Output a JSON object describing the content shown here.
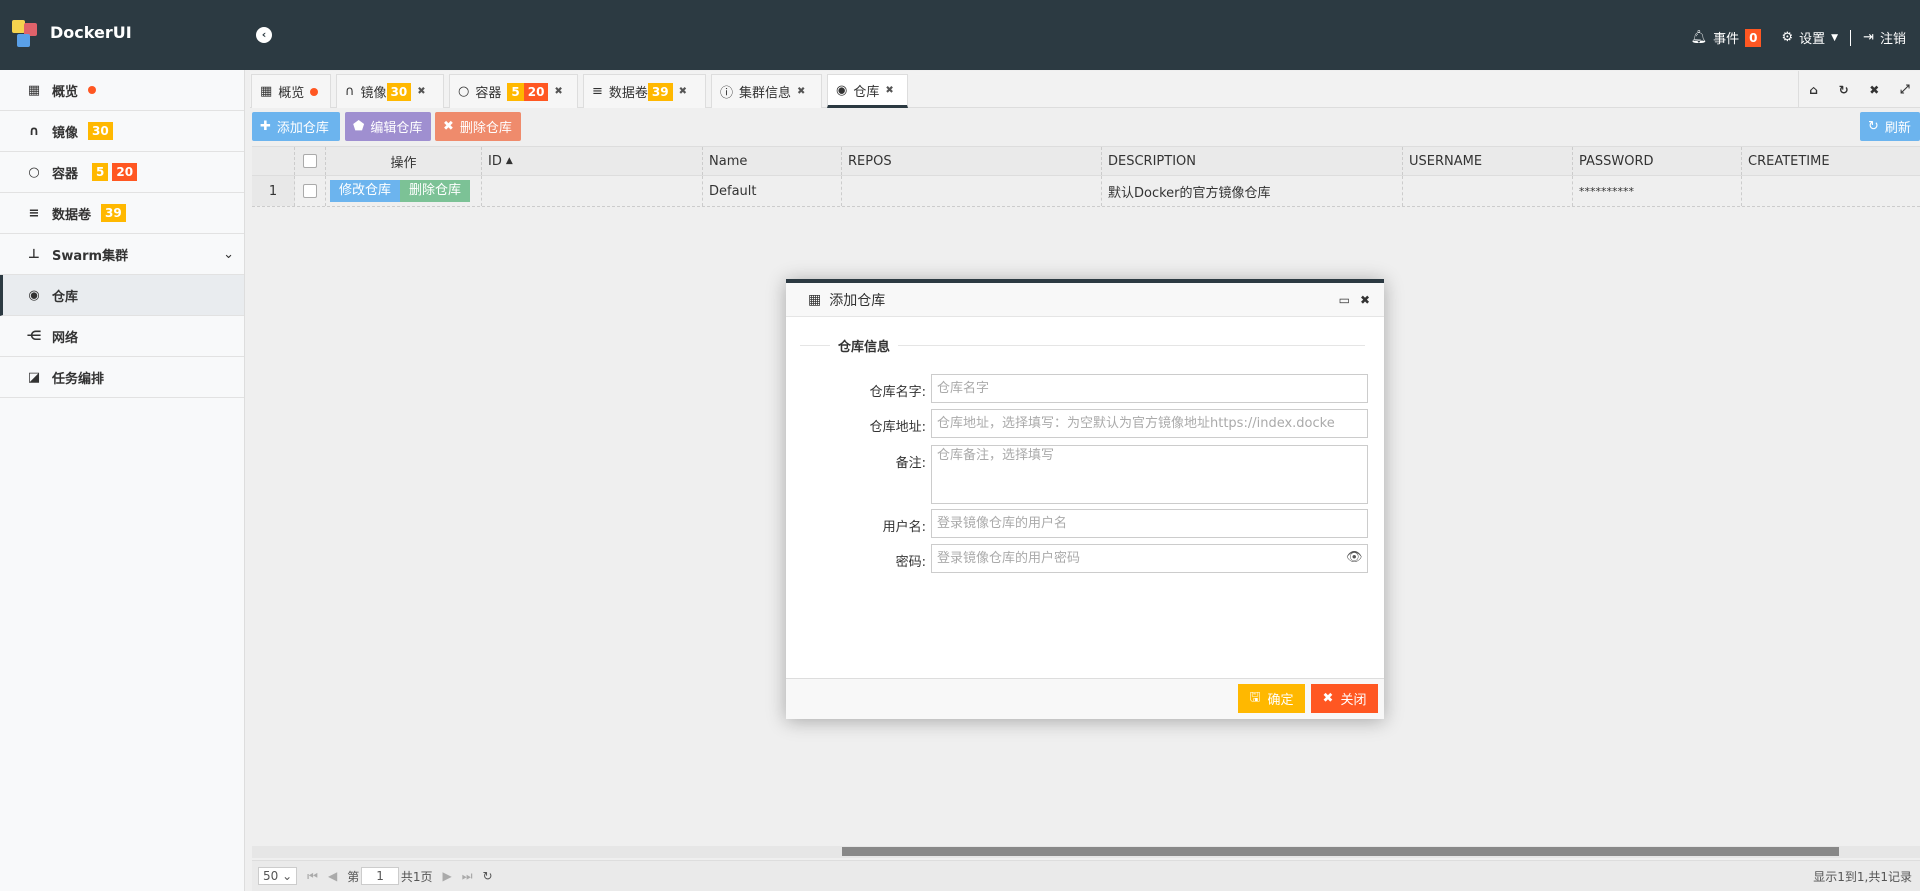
{
  "header": {
    "brand": "DockerUI",
    "events_label": "事件",
    "events_count": "0",
    "settings_label": "设置",
    "logout_label": "注销"
  },
  "sidebar": {
    "items": [
      {
        "label": "概览"
      },
      {
        "label": "镜像",
        "badge": "30"
      },
      {
        "label": "容器",
        "badge1": "5",
        "badge2": "20"
      },
      {
        "label": "数据卷",
        "badge": "39"
      },
      {
        "label": "Swarm集群"
      },
      {
        "label": "仓库"
      },
      {
        "label": "网络"
      },
      {
        "label": "任务编排"
      }
    ]
  },
  "tabs": [
    {
      "label": "概览"
    },
    {
      "label": "镜像",
      "badge": "30"
    },
    {
      "label": "容器",
      "badge1": "5",
      "badge2": "20"
    },
    {
      "label": "数据卷",
      "badge": "39"
    },
    {
      "label": "集群信息"
    },
    {
      "label": "仓库"
    }
  ],
  "toolbar": {
    "add": "添加仓库",
    "edit": "编辑仓库",
    "delete": "删除仓库",
    "refresh": "刷新"
  },
  "table": {
    "columns": [
      "操作",
      "ID",
      "Name",
      "REPOS",
      "DESCRIPTION",
      "USERNAME",
      "PASSWORD",
      "CREATETIME"
    ],
    "rows": [
      {
        "num": "1",
        "edit": "修改仓库",
        "del": "删除仓库",
        "id": "",
        "name": "Default",
        "repos": "",
        "description": "默认Docker的官方镜像仓库",
        "username": "",
        "password": "**********",
        "createtime": ""
      }
    ]
  },
  "pager": {
    "page_size": "50",
    "page_prefix": "第",
    "page": "1",
    "page_suffix": "共1页",
    "summary": "显示1到1,共1记录"
  },
  "dialog": {
    "title": "添加仓库",
    "section": "仓库信息",
    "fields": [
      {
        "label": "仓库名字:",
        "placeholder": "仓库名字"
      },
      {
        "label": "仓库地址:",
        "placeholder": "仓库地址，选择填写：为空默认为官方镜像地址https://index.docke"
      },
      {
        "label": "备注:",
        "placeholder": "仓库备注，选择填写"
      },
      {
        "label": "用户名:",
        "placeholder": "登录镜像仓库的用户名"
      },
      {
        "label": "密码:",
        "placeholder": "登录镜像仓库的用户密码"
      }
    ],
    "ok": "确定",
    "close": "关闭"
  }
}
